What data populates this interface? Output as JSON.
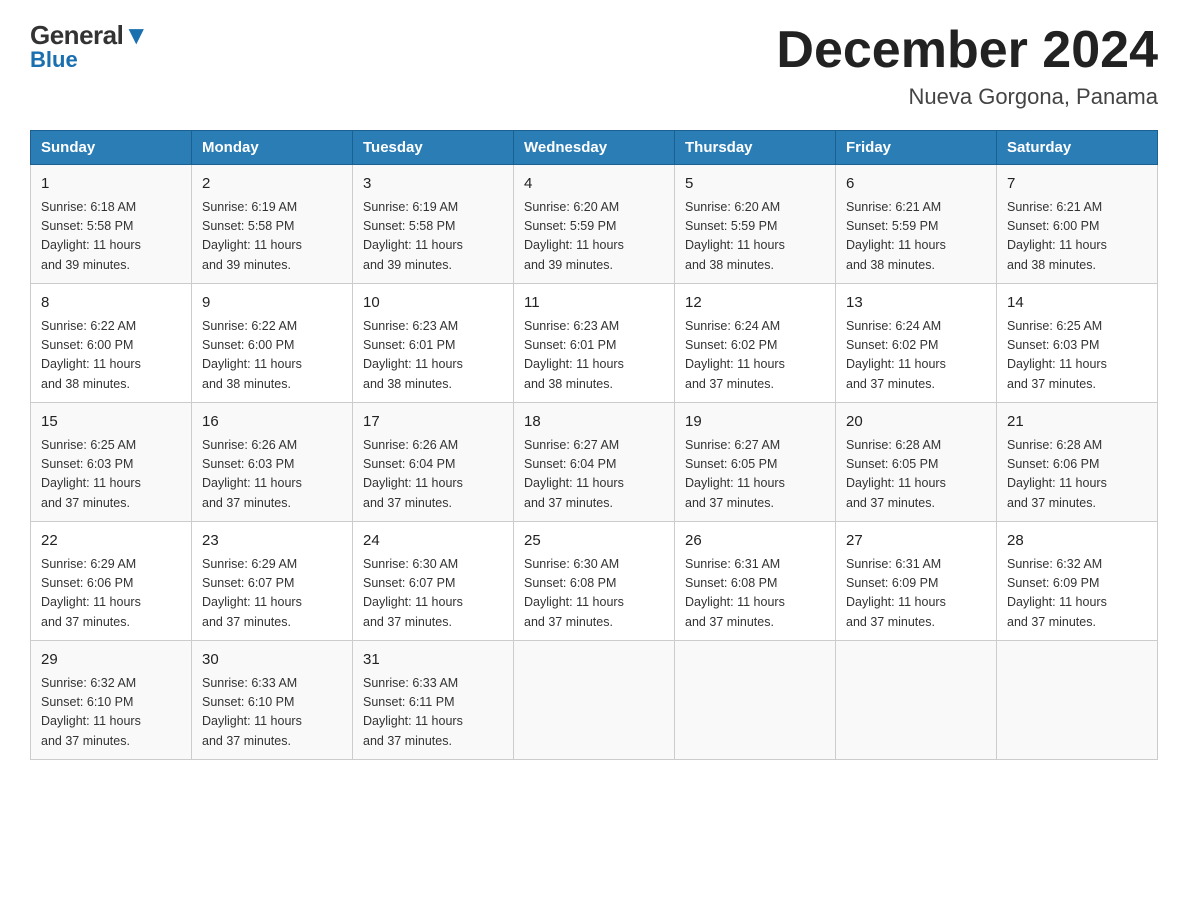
{
  "header": {
    "logo_top": "General",
    "logo_bottom": "Blue",
    "month_title": "December 2024",
    "location": "Nueva Gorgona, Panama"
  },
  "days_of_week": [
    "Sunday",
    "Monday",
    "Tuesday",
    "Wednesday",
    "Thursday",
    "Friday",
    "Saturday"
  ],
  "weeks": [
    [
      {
        "day": "1",
        "sunrise": "6:18 AM",
        "sunset": "5:58 PM",
        "daylight": "11 hours and 39 minutes."
      },
      {
        "day": "2",
        "sunrise": "6:19 AM",
        "sunset": "5:58 PM",
        "daylight": "11 hours and 39 minutes."
      },
      {
        "day": "3",
        "sunrise": "6:19 AM",
        "sunset": "5:58 PM",
        "daylight": "11 hours and 39 minutes."
      },
      {
        "day": "4",
        "sunrise": "6:20 AM",
        "sunset": "5:59 PM",
        "daylight": "11 hours and 39 minutes."
      },
      {
        "day": "5",
        "sunrise": "6:20 AM",
        "sunset": "5:59 PM",
        "daylight": "11 hours and 38 minutes."
      },
      {
        "day": "6",
        "sunrise": "6:21 AM",
        "sunset": "5:59 PM",
        "daylight": "11 hours and 38 minutes."
      },
      {
        "day": "7",
        "sunrise": "6:21 AM",
        "sunset": "6:00 PM",
        "daylight": "11 hours and 38 minutes."
      }
    ],
    [
      {
        "day": "8",
        "sunrise": "6:22 AM",
        "sunset": "6:00 PM",
        "daylight": "11 hours and 38 minutes."
      },
      {
        "day": "9",
        "sunrise": "6:22 AM",
        "sunset": "6:00 PM",
        "daylight": "11 hours and 38 minutes."
      },
      {
        "day": "10",
        "sunrise": "6:23 AM",
        "sunset": "6:01 PM",
        "daylight": "11 hours and 38 minutes."
      },
      {
        "day": "11",
        "sunrise": "6:23 AM",
        "sunset": "6:01 PM",
        "daylight": "11 hours and 38 minutes."
      },
      {
        "day": "12",
        "sunrise": "6:24 AM",
        "sunset": "6:02 PM",
        "daylight": "11 hours and 37 minutes."
      },
      {
        "day": "13",
        "sunrise": "6:24 AM",
        "sunset": "6:02 PM",
        "daylight": "11 hours and 37 minutes."
      },
      {
        "day": "14",
        "sunrise": "6:25 AM",
        "sunset": "6:03 PM",
        "daylight": "11 hours and 37 minutes."
      }
    ],
    [
      {
        "day": "15",
        "sunrise": "6:25 AM",
        "sunset": "6:03 PM",
        "daylight": "11 hours and 37 minutes."
      },
      {
        "day": "16",
        "sunrise": "6:26 AM",
        "sunset": "6:03 PM",
        "daylight": "11 hours and 37 minutes."
      },
      {
        "day": "17",
        "sunrise": "6:26 AM",
        "sunset": "6:04 PM",
        "daylight": "11 hours and 37 minutes."
      },
      {
        "day": "18",
        "sunrise": "6:27 AM",
        "sunset": "6:04 PM",
        "daylight": "11 hours and 37 minutes."
      },
      {
        "day": "19",
        "sunrise": "6:27 AM",
        "sunset": "6:05 PM",
        "daylight": "11 hours and 37 minutes."
      },
      {
        "day": "20",
        "sunrise": "6:28 AM",
        "sunset": "6:05 PM",
        "daylight": "11 hours and 37 minutes."
      },
      {
        "day": "21",
        "sunrise": "6:28 AM",
        "sunset": "6:06 PM",
        "daylight": "11 hours and 37 minutes."
      }
    ],
    [
      {
        "day": "22",
        "sunrise": "6:29 AM",
        "sunset": "6:06 PM",
        "daylight": "11 hours and 37 minutes."
      },
      {
        "day": "23",
        "sunrise": "6:29 AM",
        "sunset": "6:07 PM",
        "daylight": "11 hours and 37 minutes."
      },
      {
        "day": "24",
        "sunrise": "6:30 AM",
        "sunset": "6:07 PM",
        "daylight": "11 hours and 37 minutes."
      },
      {
        "day": "25",
        "sunrise": "6:30 AM",
        "sunset": "6:08 PM",
        "daylight": "11 hours and 37 minutes."
      },
      {
        "day": "26",
        "sunrise": "6:31 AM",
        "sunset": "6:08 PM",
        "daylight": "11 hours and 37 minutes."
      },
      {
        "day": "27",
        "sunrise": "6:31 AM",
        "sunset": "6:09 PM",
        "daylight": "11 hours and 37 minutes."
      },
      {
        "day": "28",
        "sunrise": "6:32 AM",
        "sunset": "6:09 PM",
        "daylight": "11 hours and 37 minutes."
      }
    ],
    [
      {
        "day": "29",
        "sunrise": "6:32 AM",
        "sunset": "6:10 PM",
        "daylight": "11 hours and 37 minutes."
      },
      {
        "day": "30",
        "sunrise": "6:33 AM",
        "sunset": "6:10 PM",
        "daylight": "11 hours and 37 minutes."
      },
      {
        "day": "31",
        "sunrise": "6:33 AM",
        "sunset": "6:11 PM",
        "daylight": "11 hours and 37 minutes."
      },
      {
        "day": "",
        "sunrise": "",
        "sunset": "",
        "daylight": ""
      },
      {
        "day": "",
        "sunrise": "",
        "sunset": "",
        "daylight": ""
      },
      {
        "day": "",
        "sunrise": "",
        "sunset": "",
        "daylight": ""
      },
      {
        "day": "",
        "sunrise": "",
        "sunset": "",
        "daylight": ""
      }
    ]
  ],
  "labels": {
    "sunrise": "Sunrise:",
    "sunset": "Sunset:",
    "daylight": "Daylight:"
  }
}
